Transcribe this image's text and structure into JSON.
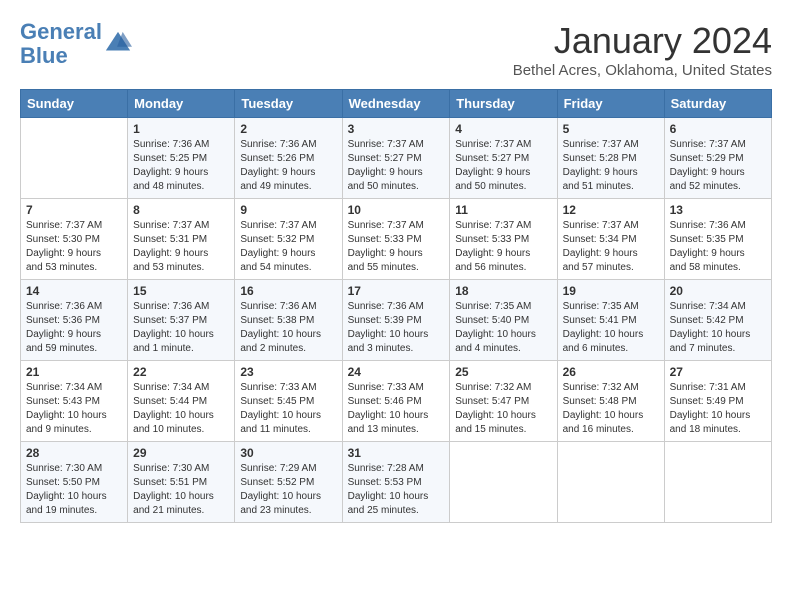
{
  "header": {
    "logo_line1": "General",
    "logo_line2": "Blue",
    "month_year": "January 2024",
    "location": "Bethel Acres, Oklahoma, United States"
  },
  "days_of_week": [
    "Sunday",
    "Monday",
    "Tuesday",
    "Wednesday",
    "Thursday",
    "Friday",
    "Saturday"
  ],
  "weeks": [
    [
      {
        "num": "",
        "info": ""
      },
      {
        "num": "1",
        "info": "Sunrise: 7:36 AM\nSunset: 5:25 PM\nDaylight: 9 hours\nand 48 minutes."
      },
      {
        "num": "2",
        "info": "Sunrise: 7:36 AM\nSunset: 5:26 PM\nDaylight: 9 hours\nand 49 minutes."
      },
      {
        "num": "3",
        "info": "Sunrise: 7:37 AM\nSunset: 5:27 PM\nDaylight: 9 hours\nand 50 minutes."
      },
      {
        "num": "4",
        "info": "Sunrise: 7:37 AM\nSunset: 5:27 PM\nDaylight: 9 hours\nand 50 minutes."
      },
      {
        "num": "5",
        "info": "Sunrise: 7:37 AM\nSunset: 5:28 PM\nDaylight: 9 hours\nand 51 minutes."
      },
      {
        "num": "6",
        "info": "Sunrise: 7:37 AM\nSunset: 5:29 PM\nDaylight: 9 hours\nand 52 minutes."
      }
    ],
    [
      {
        "num": "7",
        "info": "Sunrise: 7:37 AM\nSunset: 5:30 PM\nDaylight: 9 hours\nand 53 minutes."
      },
      {
        "num": "8",
        "info": "Sunrise: 7:37 AM\nSunset: 5:31 PM\nDaylight: 9 hours\nand 53 minutes."
      },
      {
        "num": "9",
        "info": "Sunrise: 7:37 AM\nSunset: 5:32 PM\nDaylight: 9 hours\nand 54 minutes."
      },
      {
        "num": "10",
        "info": "Sunrise: 7:37 AM\nSunset: 5:33 PM\nDaylight: 9 hours\nand 55 minutes."
      },
      {
        "num": "11",
        "info": "Sunrise: 7:37 AM\nSunset: 5:33 PM\nDaylight: 9 hours\nand 56 minutes."
      },
      {
        "num": "12",
        "info": "Sunrise: 7:37 AM\nSunset: 5:34 PM\nDaylight: 9 hours\nand 57 minutes."
      },
      {
        "num": "13",
        "info": "Sunrise: 7:36 AM\nSunset: 5:35 PM\nDaylight: 9 hours\nand 58 minutes."
      }
    ],
    [
      {
        "num": "14",
        "info": "Sunrise: 7:36 AM\nSunset: 5:36 PM\nDaylight: 9 hours\nand 59 minutes."
      },
      {
        "num": "15",
        "info": "Sunrise: 7:36 AM\nSunset: 5:37 PM\nDaylight: 10 hours\nand 1 minute."
      },
      {
        "num": "16",
        "info": "Sunrise: 7:36 AM\nSunset: 5:38 PM\nDaylight: 10 hours\nand 2 minutes."
      },
      {
        "num": "17",
        "info": "Sunrise: 7:36 AM\nSunset: 5:39 PM\nDaylight: 10 hours\nand 3 minutes."
      },
      {
        "num": "18",
        "info": "Sunrise: 7:35 AM\nSunset: 5:40 PM\nDaylight: 10 hours\nand 4 minutes."
      },
      {
        "num": "19",
        "info": "Sunrise: 7:35 AM\nSunset: 5:41 PM\nDaylight: 10 hours\nand 6 minutes."
      },
      {
        "num": "20",
        "info": "Sunrise: 7:34 AM\nSunset: 5:42 PM\nDaylight: 10 hours\nand 7 minutes."
      }
    ],
    [
      {
        "num": "21",
        "info": "Sunrise: 7:34 AM\nSunset: 5:43 PM\nDaylight: 10 hours\nand 9 minutes."
      },
      {
        "num": "22",
        "info": "Sunrise: 7:34 AM\nSunset: 5:44 PM\nDaylight: 10 hours\nand 10 minutes."
      },
      {
        "num": "23",
        "info": "Sunrise: 7:33 AM\nSunset: 5:45 PM\nDaylight: 10 hours\nand 11 minutes."
      },
      {
        "num": "24",
        "info": "Sunrise: 7:33 AM\nSunset: 5:46 PM\nDaylight: 10 hours\nand 13 minutes."
      },
      {
        "num": "25",
        "info": "Sunrise: 7:32 AM\nSunset: 5:47 PM\nDaylight: 10 hours\nand 15 minutes."
      },
      {
        "num": "26",
        "info": "Sunrise: 7:32 AM\nSunset: 5:48 PM\nDaylight: 10 hours\nand 16 minutes."
      },
      {
        "num": "27",
        "info": "Sunrise: 7:31 AM\nSunset: 5:49 PM\nDaylight: 10 hours\nand 18 minutes."
      }
    ],
    [
      {
        "num": "28",
        "info": "Sunrise: 7:30 AM\nSunset: 5:50 PM\nDaylight: 10 hours\nand 19 minutes."
      },
      {
        "num": "29",
        "info": "Sunrise: 7:30 AM\nSunset: 5:51 PM\nDaylight: 10 hours\nand 21 minutes."
      },
      {
        "num": "30",
        "info": "Sunrise: 7:29 AM\nSunset: 5:52 PM\nDaylight: 10 hours\nand 23 minutes."
      },
      {
        "num": "31",
        "info": "Sunrise: 7:28 AM\nSunset: 5:53 PM\nDaylight: 10 hours\nand 25 minutes."
      },
      {
        "num": "",
        "info": ""
      },
      {
        "num": "",
        "info": ""
      },
      {
        "num": "",
        "info": ""
      }
    ]
  ]
}
